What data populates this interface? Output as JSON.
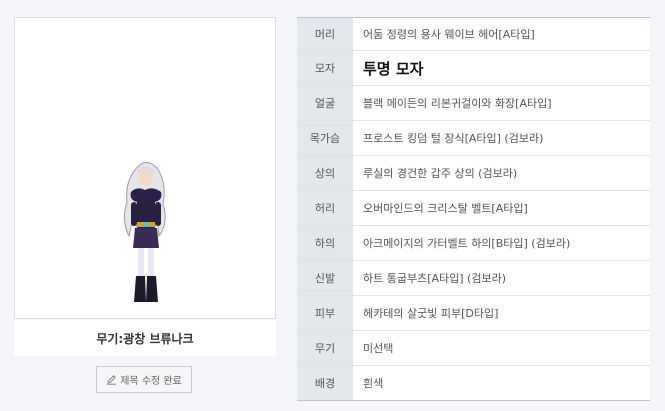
{
  "caption": "무기:광창 브류나크",
  "edit_button": {
    "label": "제목 수정 완료",
    "icon": "pencil-icon"
  },
  "equipment": [
    {
      "slot": "머리",
      "item": "어둠 정령의 용사 웨이브 헤어[A타입]"
    },
    {
      "slot": "모자",
      "item": "투명 모자"
    },
    {
      "slot": "얼굴",
      "item": "블랙 메이든의 리본귀걸이와 화장[A타입]"
    },
    {
      "slot": "목가슴",
      "item": "프로스트 킹덤 털 장식[A타입] (검보라)"
    },
    {
      "slot": "상의",
      "item": "루실의 경건한 갑주 상의 (검보라)"
    },
    {
      "slot": "허리",
      "item": "오버마인드의 크리스탈 벨트[A타입]"
    },
    {
      "slot": "하의",
      "item": "아크메이지의 가터벨트 하의[B타입] (검보라)"
    },
    {
      "slot": "신발",
      "item": "하트 통굽부츠[A타입] (검보라)"
    },
    {
      "slot": "피부",
      "item": "헤카테의 살굿빛 피부[D타입]"
    },
    {
      "slot": "무기",
      "item": "미선택"
    },
    {
      "slot": "배경",
      "item": "흰색"
    }
  ],
  "colors": {
    "page_bg": "#f3f5f9",
    "label_bg": "#e4e7ec",
    "border": "#bfc3cb"
  }
}
